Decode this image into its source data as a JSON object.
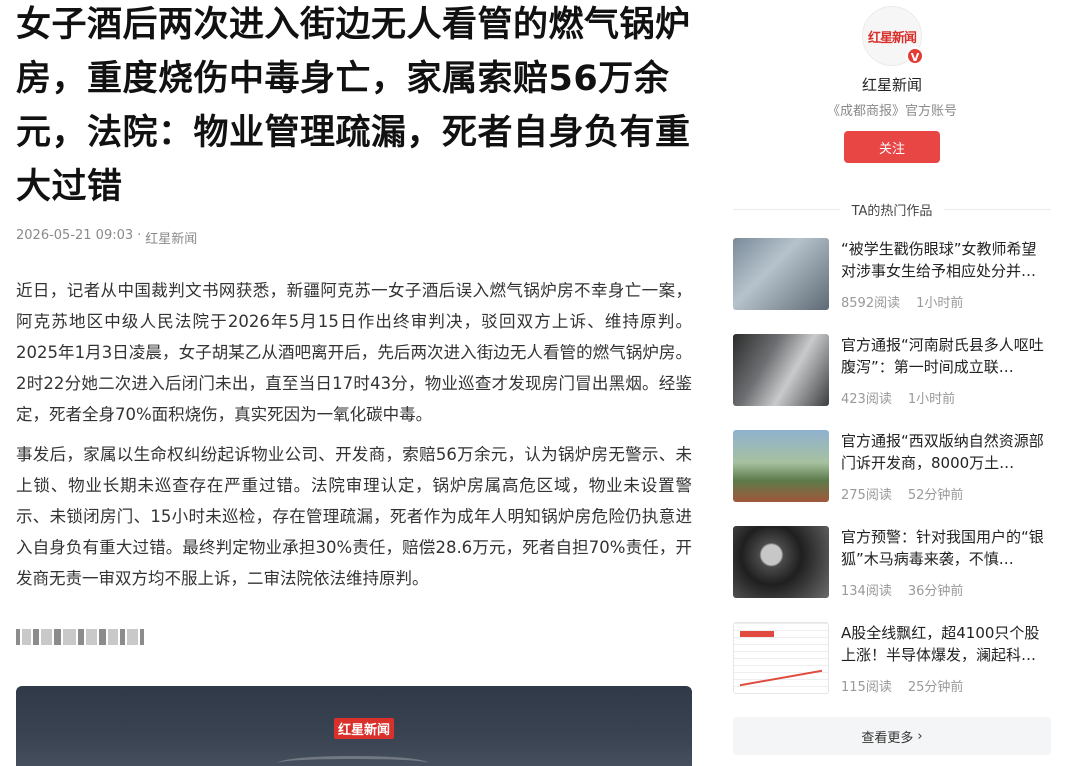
{
  "article": {
    "title": "女子酒后两次进入街边无人看管的燃气锅炉房，重度烧伤中毒身亡，家属索赔56万余元，法院：物业管理疏漏，死者自身负有重大过错",
    "date": "2026-05-21 09:03",
    "separator": "·",
    "source": "红星新闻",
    "paragraphs": [
      "近日，记者从中国裁判文书网获悉，新疆阿克苏一女子酒后误入燃气锅炉房不幸身亡一案，阿克苏地区中级人民法院于2026年5月15日作出终审判决，驳回双方上诉、维持原判。2025年1月3日凌晨，女子胡某乙从酒吧离开后，先后两次进入街边无人看管的燃气锅炉房。2时22分她二次进入后闭门未出，直至当日17时43分，物业巡查才发现房门冒出黑烟。经鉴定，死者全身70%面积烧伤，真实死因为一氧化碳中毒。",
      "事发后，家属以生命权纠纷起诉物业公司、开发商，索赔56万余元，认为锅炉房无警示、未上锁、物业长期未巡查存在严重过错。法院审理认定，锅炉房属高危区域，物业未设置警示、未锁闭房门、15小时未巡检，存在管理疏漏，死者作为成年人明知锅炉房危险仍执意进入自身负有重大过错。最终判定物业承担30%责任，赔偿28.6万元，死者自担70%责任，开发商无责一审双方均不服上诉，二审法院依法维持原判。"
    ],
    "cover_logo": "红星新闻"
  },
  "sidebar": {
    "avatar_logo": "红星新闻",
    "verified_badge": "V",
    "account_name": "红星新闻",
    "account_desc": "《成都商报》官方账号",
    "follow_label": "关注",
    "hot_header": "TA的热门作品",
    "hot_items": [
      {
        "title": "“被学生戳伤眼球”女教师希望对涉事女生给予相应处分并…",
        "reads": "8592阅读",
        "time": "1小时前"
      },
      {
        "title": "官方通报“河南尉氏县多人呕吐腹泻”：第一时间成立联…",
        "reads": "423阅读",
        "time": "1小时前"
      },
      {
        "title": "官方通报“西双版纳自然资源部门诉开发商，8000万土…",
        "reads": "275阅读",
        "time": "52分钟前"
      },
      {
        "title": "官方预警：针对我国用户的“银狐”木马病毒来袭，不慎…",
        "reads": "134阅读",
        "time": "36分钟前"
      },
      {
        "title": "A股全线飘红，超4100只个股上涨！半导体爆发，澜起科…",
        "reads": "115阅读",
        "time": "25分钟前"
      }
    ],
    "see_more_label": "查看更多"
  },
  "colors": {
    "brand_red": "#e84545",
    "muted": "#8a8a8a"
  }
}
